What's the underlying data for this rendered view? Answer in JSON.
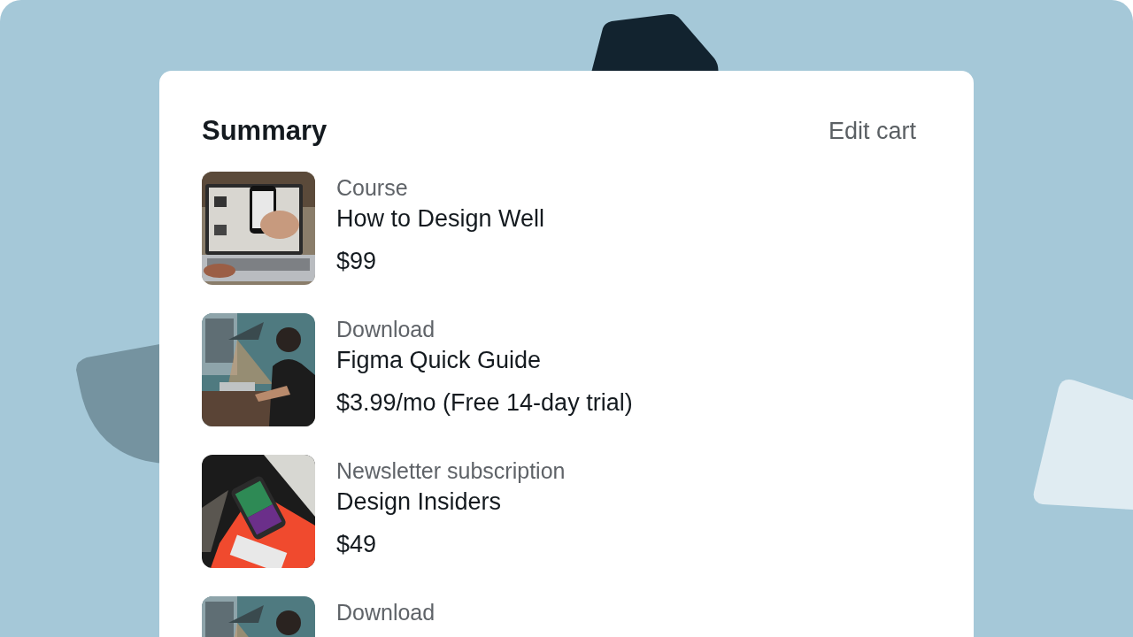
{
  "summary": {
    "title": "Summary",
    "edit_link": "Edit cart"
  },
  "items": [
    {
      "category": "Course",
      "name": "How to Design Well",
      "price": "$99",
      "kind": "picture"
    },
    {
      "category": "Download",
      "name": "Figma Quick Guide",
      "price": "$3.99/mo (Free 14-day trial)",
      "kind": "picture"
    },
    {
      "category": "Newsletter subscription",
      "name": "Design Insiders",
      "price": "$49",
      "kind": "picture"
    },
    {
      "category": "Download",
      "kind": "picture"
    }
  ]
}
